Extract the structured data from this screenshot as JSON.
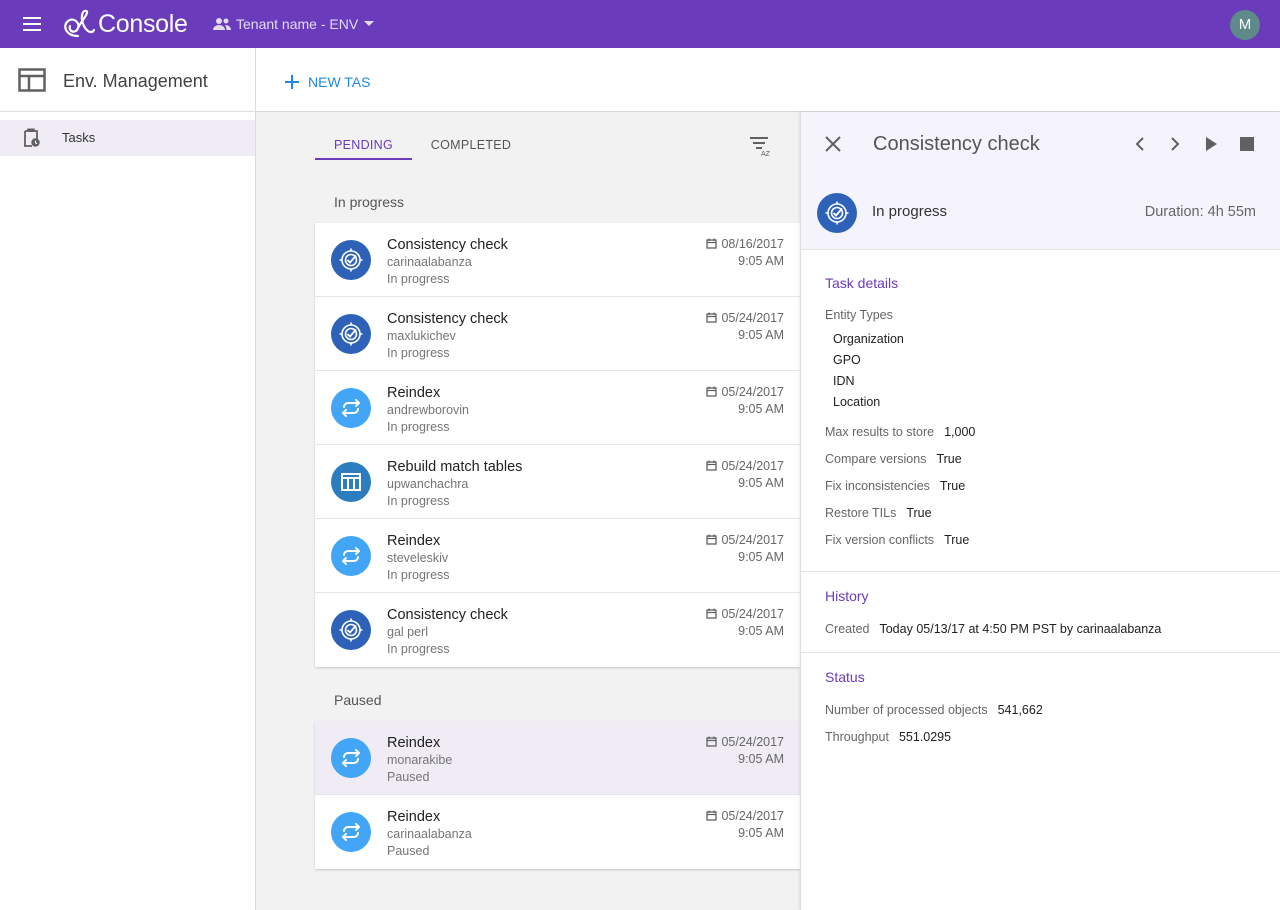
{
  "app": {
    "name": "Console",
    "tenant": "Tenant name - ENV",
    "avatar_initial": "M",
    "brand_color": "#6a3bba"
  },
  "sidebar": {
    "title": "Env. Management",
    "items": [
      {
        "label": "Tasks",
        "icon": "clipboard-clock-icon",
        "selected": true
      }
    ]
  },
  "toolbar": {
    "new_task_label": "NEW TASK"
  },
  "tabs": [
    {
      "label": "PENDING",
      "active": true
    },
    {
      "label": "COMPLETED",
      "active": false
    }
  ],
  "groups": {
    "in_progress": {
      "label": "In progress",
      "tasks": [
        {
          "name": "Consistency check",
          "user": "carinaalabanza",
          "state": "In progress",
          "date": "08/16/2017",
          "time": "9:05 AM",
          "icon": "consistency-check-icon",
          "icon_color": "#2e62b8"
        },
        {
          "name": "Consistency check",
          "user": "maxlukichev",
          "state": "In progress",
          "date": "05/24/2017",
          "time": "9:05 AM",
          "icon": "consistency-check-icon",
          "icon_color": "#2e62b8"
        },
        {
          "name": "Reindex",
          "user": "andrewborovin",
          "state": "In progress",
          "date": "05/24/2017",
          "time": "9:05 AM",
          "icon": "reindex-icon",
          "icon_color": "#42a5f5"
        },
        {
          "name": "Rebuild match tables",
          "user": "upwanchachra",
          "state": "In progress",
          "date": "05/24/2017",
          "time": "9:05 AM",
          "icon": "match-tables-icon",
          "icon_color": "#2b7dc0"
        },
        {
          "name": "Reindex",
          "user": "steveleskiv",
          "state": "In progress",
          "date": "05/24/2017",
          "time": "9:05 AM",
          "icon": "reindex-icon",
          "icon_color": "#42a5f5"
        },
        {
          "name": "Consistency check",
          "user": "gal perl",
          "state": "In progress",
          "date": "05/24/2017",
          "time": "9:05 AM",
          "icon": "consistency-check-icon",
          "icon_color": "#2e62b8"
        }
      ]
    },
    "paused": {
      "label": "Paused",
      "tasks": [
        {
          "name": "Reindex",
          "user": "monarakibe",
          "state": "Paused",
          "date": "05/24/2017",
          "time": "9:05 AM",
          "icon": "reindex-icon",
          "icon_color": "#42a5f5",
          "selected": true
        },
        {
          "name": "Reindex",
          "user": "carinaalabanza",
          "state": "Paused",
          "date": "05/24/2017",
          "time": "9:05 AM",
          "icon": "reindex-icon",
          "icon_color": "#42a5f5"
        }
      ]
    }
  },
  "details": {
    "title": "Consistency check",
    "status": "In progress",
    "duration": "Duration: 4h 55m",
    "task_details": {
      "heading": "Task details",
      "entity_types_label": "Entity Types",
      "entity_types": [
        "Organization",
        "GPO",
        "IDN",
        "Location"
      ],
      "fields": [
        {
          "label": "Max results to store",
          "value": "1,000"
        },
        {
          "label": "Compare versions",
          "value": "True"
        },
        {
          "label": "Fix inconsistencies",
          "value": "True"
        },
        {
          "label": "Restore TILs",
          "value": "True"
        },
        {
          "label": "Fix version conflicts",
          "value": "True"
        }
      ]
    },
    "history": {
      "heading": "History",
      "created_label": "Created",
      "created_value": "Today 05/13/17 at 4:50 PM PST by carinaalabanza"
    },
    "status_section": {
      "heading": "Status",
      "fields": [
        {
          "label": "Number of processed objects",
          "value": "541,662"
        },
        {
          "label": "Throughput",
          "value": "551.0295"
        }
      ]
    }
  }
}
